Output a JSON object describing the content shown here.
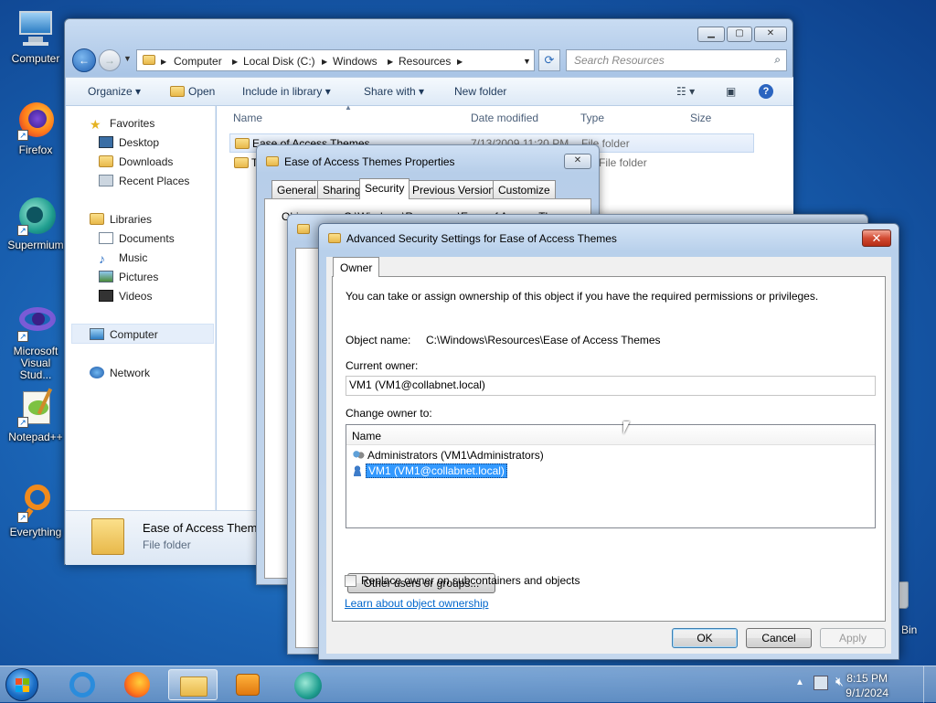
{
  "desktop": {
    "icons": [
      {
        "label": "Computer"
      },
      {
        "label": "Firefox"
      },
      {
        "label": "Supermium"
      },
      {
        "label": "Microsoft Visual Stud..."
      },
      {
        "label": "Notepad++"
      },
      {
        "label": "Everything"
      }
    ],
    "recycle_bin_label": "Bin"
  },
  "explorer": {
    "breadcrumb": [
      "Computer",
      "Local Disk (C:)",
      "Windows",
      "Resources"
    ],
    "search_placeholder": "Search Resources",
    "toolbar": {
      "organize": "Organize",
      "open": "Open",
      "include_in_library": "Include in library",
      "share_with": "Share with",
      "new_folder": "New folder"
    },
    "nav": {
      "favorites": "Favorites",
      "favorites_items": [
        "Desktop",
        "Downloads",
        "Recent Places"
      ],
      "libraries": "Libraries",
      "libraries_items": [
        "Documents",
        "Music",
        "Pictures",
        "Videos"
      ],
      "computer": "Computer",
      "network": "Network"
    },
    "columns": {
      "name": "Name",
      "date_modified": "Date modified",
      "type": "Type",
      "size": "Size"
    },
    "rows": [
      {
        "name": "Ease of Access Themes",
        "date": "7/13/2009 11:20 PM",
        "type": "File folder"
      },
      {
        "name": "T",
        "date": "",
        "type": "File folder"
      }
    ],
    "details": {
      "name": "Ease of Access Theme",
      "type": "File folder"
    }
  },
  "properties": {
    "title": "Ease of Access Themes Properties",
    "tabs": [
      "General",
      "Sharing",
      "Security",
      "Previous Versions",
      "Customize"
    ],
    "active_tab": "Security",
    "object_label_fragment": "Obj",
    "object_path_fragment": "C:\\Windows\\Resources\\Ease of Access The"
  },
  "advanced": {
    "title": "Advanced Security Settings for Ease of Access Themes",
    "tab": "Owner",
    "intro": "You can take or assign ownership of this object if you have the required permissions or privileges.",
    "object_name_label": "Object name:",
    "object_name_value": "C:\\Windows\\Resources\\Ease of Access Themes",
    "current_owner_label": "Current owner:",
    "current_owner_value": "VM1 (VM1@collabnet.local)",
    "change_owner_label": "Change owner to:",
    "list_header": "Name",
    "list_items": [
      "Administrators (VM1\\Administrators)",
      "VM1 (VM1@collabnet.local)"
    ],
    "selected_index": 1,
    "other_users_button": "Other users or groups...",
    "replace_owner_label": "Replace owner on subcontainers and objects",
    "learn_link": "Learn about object ownership",
    "ok": "OK",
    "cancel": "Cancel",
    "apply": "Apply"
  },
  "taskbar": {
    "time": "8:15 PM",
    "date": "9/1/2024"
  },
  "colors": {
    "accent": "#3399ff",
    "selection": "#3399ff",
    "link": "#0066cc",
    "close_red": "#c7402a"
  }
}
